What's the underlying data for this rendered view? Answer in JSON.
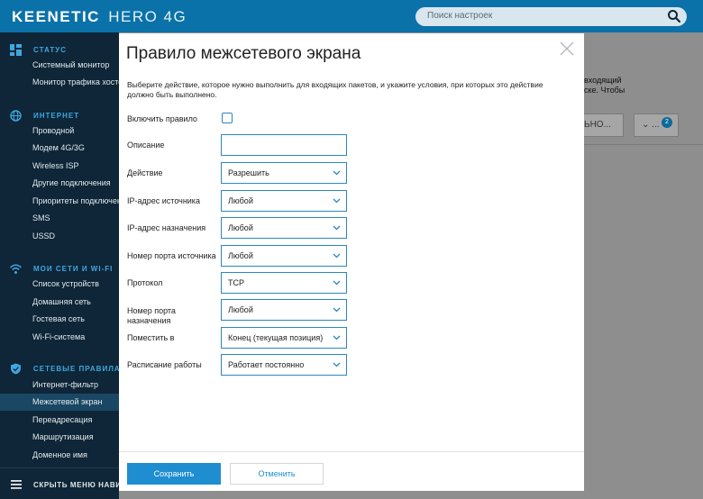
{
  "header": {
    "brand": "KEENETIC",
    "model": "HERO 4G",
    "search_placeholder": "Поиск настроек"
  },
  "sidebar": {
    "sections": [
      {
        "title": "СТАТУС",
        "icon": "dashboard-icon",
        "items": [
          "Системный монитор",
          "Монитор трафика хостов"
        ]
      },
      {
        "title": "ИНТЕРНЕТ",
        "icon": "globe-icon",
        "items": [
          "Проводной",
          "Модем 4G/3G",
          "Wireless ISP",
          "Другие подключения",
          "Приоритеты подключений",
          "SMS",
          "USSD"
        ]
      },
      {
        "title": "МОИ СЕТИ И WI-FI",
        "icon": "wifi-icon",
        "items": [
          "Список устройств",
          "Домашняя сеть",
          "Гостевая сеть",
          "Wi-Fi-система"
        ]
      },
      {
        "title": "СЕТЕВЫЕ ПРАВИЛА",
        "icon": "shield-icon",
        "items": [
          "Интернет-фильтр",
          "Межсетевой экран",
          "Переадресация",
          "Маршрутизация",
          "Доменное имя"
        ]
      }
    ],
    "active_item": "Межсетевой экран",
    "hide_label": "СКРЫТЬ МЕНЮ НАВИГАЦИИ"
  },
  "background": {
    "text_line1": "входящий",
    "text_line2": "ске. Чтобы",
    "btn1": "ЬНО...",
    "btn2": "...",
    "badge": "2"
  },
  "modal": {
    "title": "Правило межсетевого экрана",
    "description": "Выберите действие, которое нужно выполнить для входящих пакетов, и укажите условия, при которых это действие должно быть выполнено.",
    "fields": {
      "enable": {
        "label": "Включить правило",
        "checked": false
      },
      "description": {
        "label": "Описание",
        "value": ""
      },
      "action": {
        "label": "Действие",
        "value": "Разрешить"
      },
      "src_ip": {
        "label": "IP-адрес источника",
        "value": "Любой"
      },
      "dst_ip": {
        "label": "IP-адрес назначения",
        "value": "Любой"
      },
      "src_port": {
        "label": "Номер порта источника",
        "value": "Любой"
      },
      "protocol": {
        "label": "Протокол",
        "value": "TCP"
      },
      "dst_port": {
        "label_line1": "Номер порта",
        "label_line2": "назначения",
        "value": "Любой"
      },
      "position": {
        "label": "Поместить в",
        "value": "Конец (текущая позиция)"
      },
      "schedule": {
        "label": "Расписание работы",
        "value": "Работает постоянно"
      }
    },
    "save_label": "Сохранить",
    "cancel_label": "Отменить"
  },
  "colors": {
    "topbar": "#0a72a8",
    "sidebar": "#0e2637",
    "section_title": "#3fa7e0",
    "accent": "#1e8ed0",
    "field_border": "#2b87bf"
  }
}
